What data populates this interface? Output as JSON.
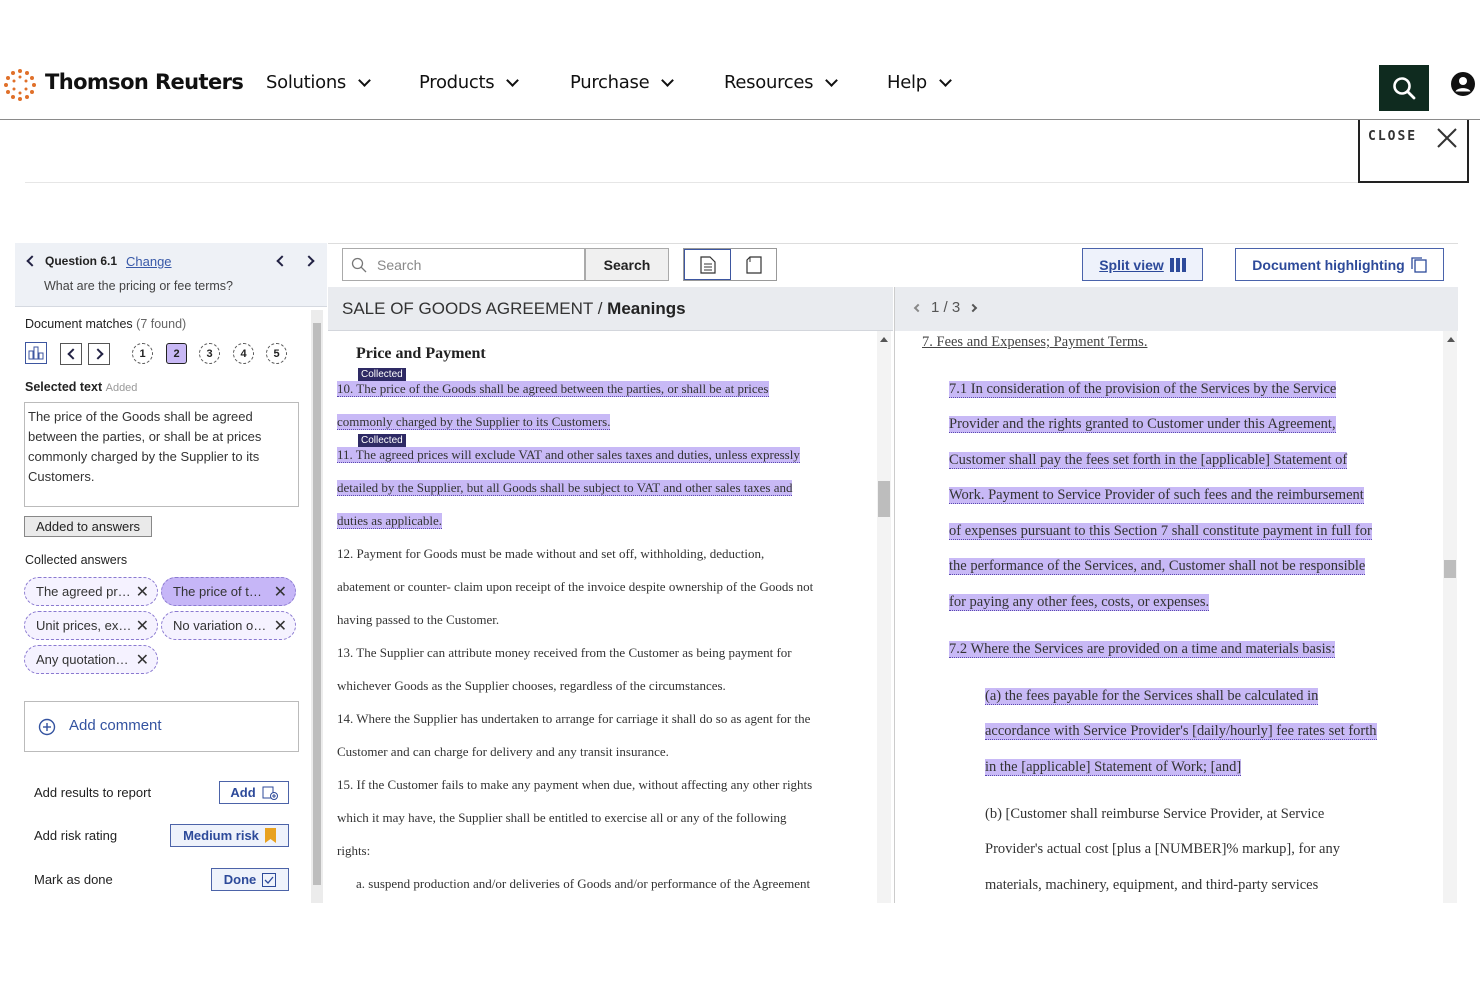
{
  "header": {
    "brand": "Thomson Reuters",
    "nav": [
      "Solutions",
      "Products",
      "Purchase",
      "Resources",
      "Help"
    ]
  },
  "close_label": "CLOSE",
  "question": {
    "title": "Question 6.1",
    "change": "Change",
    "text": "What are the pricing or fee terms?"
  },
  "matches": {
    "label": "Document matches",
    "count": "(7 found)",
    "pages": [
      "1",
      "2",
      "3",
      "4",
      "5"
    ],
    "active_page": "2"
  },
  "selected": {
    "label": "Selected text",
    "status": "Added",
    "text": "The price of the Goods shall be agreed between the parties, or shall be at prices commonly charged by the Supplier to its Customers.",
    "added_button": "Added to answers"
  },
  "collected": {
    "label": "Collected answers",
    "chips": [
      "The agreed pr…",
      "The price of t…",
      "Unit prices, ex…",
      "No variation o…",
      "Any quotation…"
    ]
  },
  "comment": "Add comment",
  "actions": {
    "report_label": "Add results to report",
    "report_button": "Add",
    "risk_label": "Add risk rating",
    "risk_button": "Medium risk",
    "done_label": "Mark as done",
    "done_button": "Done"
  },
  "toolbar": {
    "search_placeholder": "Search",
    "search_button": "Search",
    "split_view": "Split view",
    "highlighting": "Document highlighting"
  },
  "doc_left": {
    "title_main": "SALE OF GOODS AGREEMENT",
    "title_sep": "/",
    "title_section": "Meanings",
    "heading": "Price and Payment",
    "tag": "Collected",
    "lines": [
      "10. The price of the Goods shall be agreed between the parties, or shall be at prices",
      "commonly charged by the Supplier to its Customers.",
      "11. The agreed prices will exclude VAT and other sales taxes and duties, unless expressly",
      "detailed by the Supplier, but all Goods shall be subject to VAT and other sales taxes and",
      "duties as applicable.",
      "12. Payment for Goods must be made without and set off, withholding, deduction,",
      "abatement or counter- claim upon receipt of the invoice despite ownership of the Goods not",
      "having passed to the Customer.",
      "13. The Supplier can attribute money received from the Customer as being payment for",
      "whichever Goods as the Supplier chooses, regardless of the circumstances.",
      "14. Where the Supplier has undertaken to arrange for carriage it shall do so as agent for the",
      "Customer and can charge for delivery and any transit insurance.",
      "15. If the Customer fails to make any payment when due, without affecting any other rights",
      "which it may have, the Supplier shall be entitled to exercise all or any of the following",
      "rights:",
      "a. suspend production and/or deliveries of Goods and/or performance of the Agreement"
    ]
  },
  "doc_right": {
    "pager": "1 / 3",
    "heading": "7. Fees and Expenses; Payment Terms.",
    "lines": [
      "7.1 In consideration of the provision of the Services by the Service",
      "Provider and the rights granted to Customer under this Agreement,",
      "Customer shall pay the fees set forth in the [applicable] Statement of",
      "Work. Payment to Service Provider of such fees and the reimbursement",
      "of expenses pursuant to this Section 7 shall constitute payment in full for",
      "the performance of the Services, and, Customer shall not be responsible",
      "for paying any other fees, costs, or expenses.",
      "7.2 Where the Services are provided on a time and materials basis:",
      "(a) the fees payable for the Services shall be calculated in",
      "accordance with Service Provider's [daily/hourly] fee rates set forth",
      "in the [applicable] Statement of Work; [and]",
      "(b) [Customer shall reimburse Service Provider, at Service",
      "Provider's actual cost [plus a [NUMBER]% markup], for any",
      "materials, machinery, equipment, and third-party services"
    ]
  },
  "colors": {
    "highlight": "#c8b9f6",
    "accent": "#2d4a9a",
    "tag": "#2e2a64",
    "search_bg": "#0f2b1f",
    "risk_flag": "#e8a11f"
  }
}
